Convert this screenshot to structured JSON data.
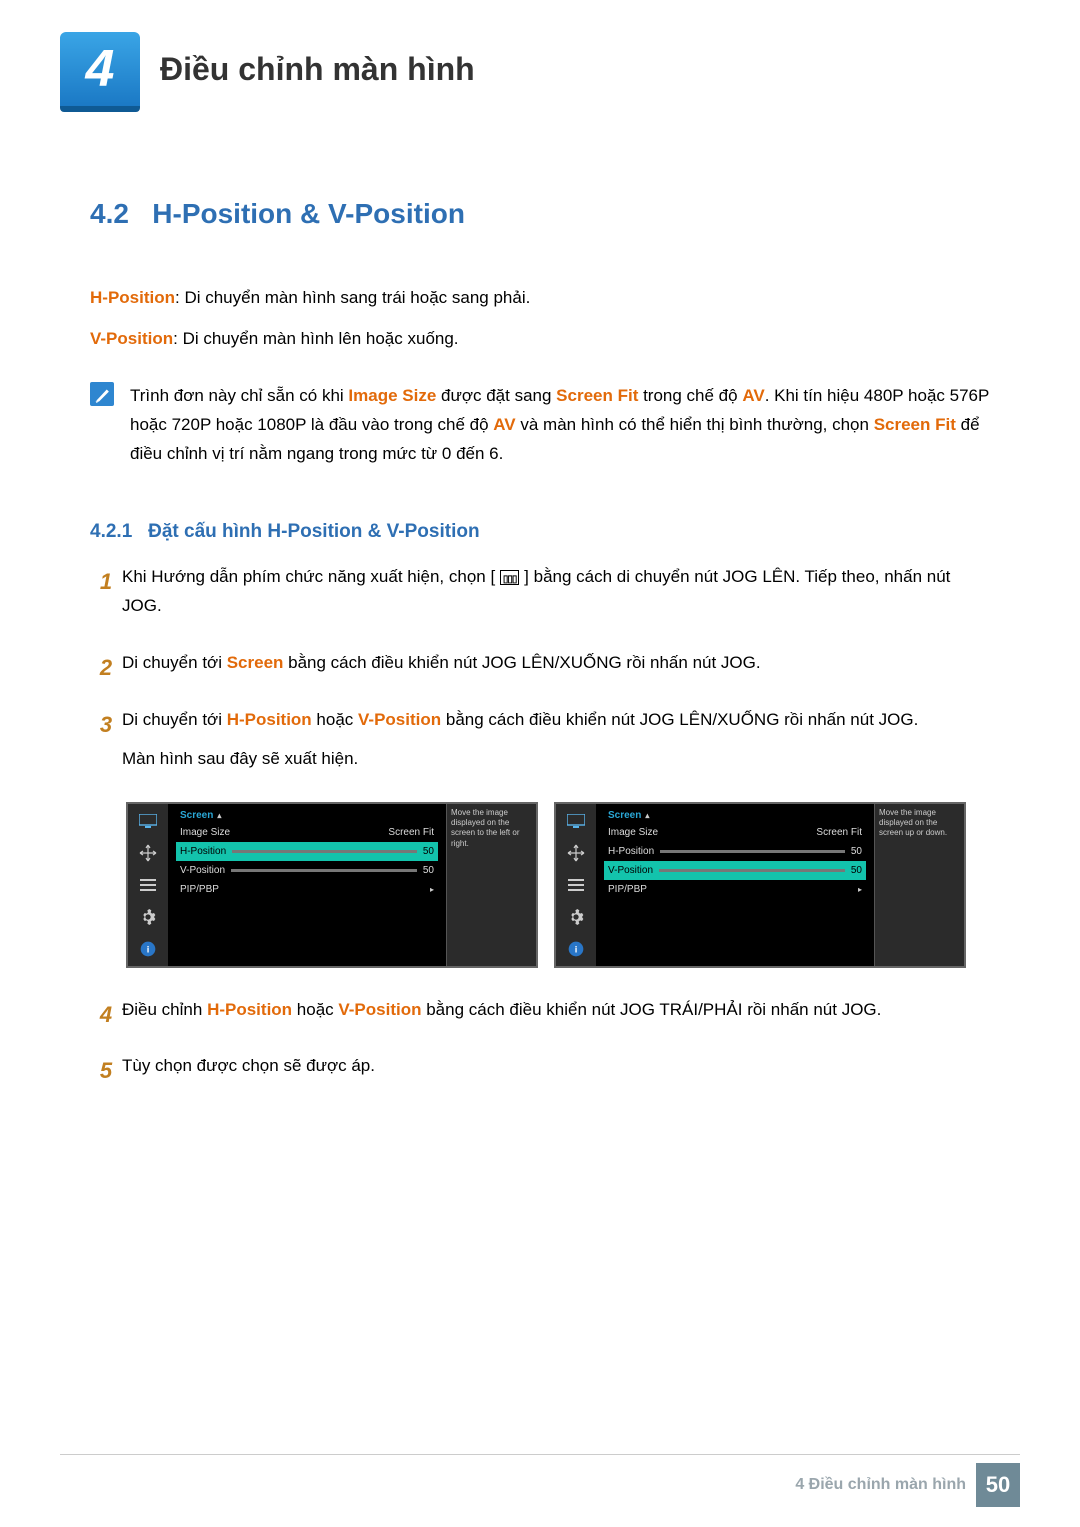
{
  "chapter": {
    "number": "4",
    "title": "Điều chỉnh màn hình"
  },
  "section": {
    "number": "4.2",
    "title": "H-Position & V-Position"
  },
  "intro": {
    "hpos_label": "H-Position",
    "hpos_text": ": Di chuyển màn hình sang trái hoặc sang phải.",
    "vpos_label": "V-Position",
    "vpos_text": ": Di chuyển màn hình lên hoặc xuống."
  },
  "note": {
    "pre": "Trình đơn này chỉ sẵn có khi ",
    "tok1": "Image Size",
    "mid1": " được đặt sang ",
    "tok2": "Screen Fit",
    "mid2": " trong chế độ ",
    "tok3": "AV",
    "mid3": ". Khi tín hiệu 480P hoặc 576P hoặc 720P hoặc 1080P là đầu vào trong chế độ ",
    "tok4": "AV",
    "mid4": " và màn hình có thể hiển thị bình thường, chọn ",
    "tok5": "Screen Fit",
    "post": " để điều chỉnh vị trí nằm ngang trong mức từ 0 đến 6."
  },
  "subsection": {
    "number": "4.2.1",
    "title": "Đặt cấu hình H-Position & V-Position"
  },
  "steps": [
    {
      "num": "1",
      "a": "Khi Hướng dẫn phím chức năng xuất hiện, chọn [",
      "b": "] bằng cách di chuyển nút JOG LÊN. Tiếp theo, nhấn nút JOG."
    },
    {
      "num": "2",
      "a": "Di chuyển tới ",
      "hl": "Screen",
      "b": " bằng cách điều khiển nút JOG LÊN/XUỐNG rồi nhấn nút JOG."
    },
    {
      "num": "3",
      "a": "Di chuyển tới ",
      "hl1": "H-Position",
      "mid": " hoặc ",
      "hl2": "V-Position",
      "b": " bằng cách điều khiển nút JOG LÊN/XUỐNG rồi nhấn nút JOG.",
      "c": "Màn hình sau đây sẽ xuất hiện."
    },
    {
      "num": "4",
      "a": "Điều chỉnh ",
      "hl1": "H-Position",
      "mid": " hoặc ",
      "hl2": "V-Position",
      "b": " bằng cách điều khiển nút JOG TRÁI/PHẢI rồi nhấn nút JOG."
    },
    {
      "num": "5",
      "a": "Tùy chọn được chọn sẽ được áp."
    }
  ],
  "osd": {
    "title": "Screen",
    "imageSize": "Image Size",
    "imageSizeVal": "Screen Fit",
    "hpos": "H-Position",
    "hval": "50",
    "vpos": "V-Position",
    "vval": "50",
    "pip": "PIP/PBP",
    "help_h": "Move the image displayed on the screen to the left or right.",
    "help_v": "Move the image displayed on the screen up or down."
  },
  "footer": {
    "chapter": "4 Điều chỉnh màn hình",
    "page": "50"
  }
}
